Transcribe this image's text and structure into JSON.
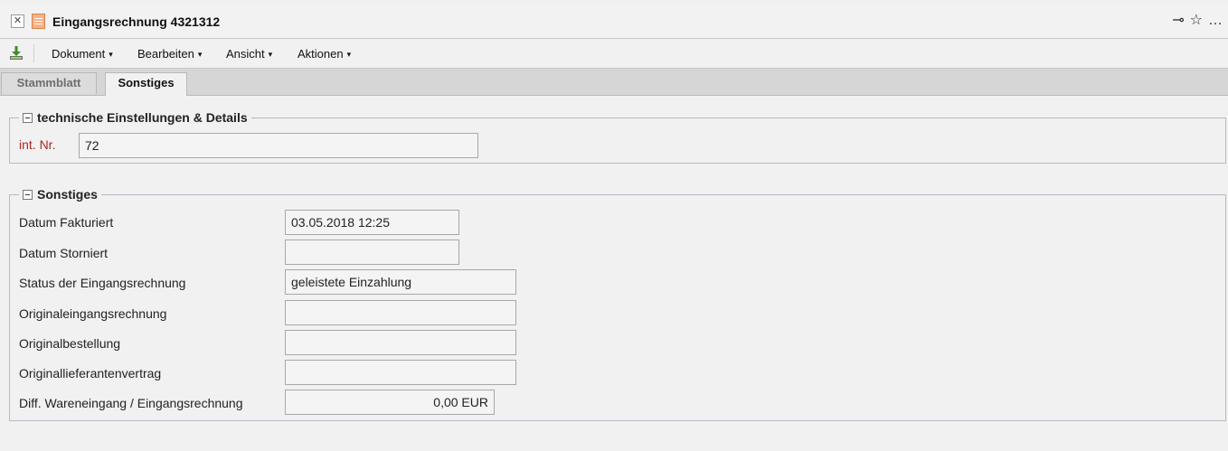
{
  "window": {
    "title": "Eingangsrechnung 4321312",
    "close_glyph": "✕",
    "key_glyph": "⊸",
    "star_glyph": "☆",
    "more_glyph": "…"
  },
  "menu": {
    "items": [
      {
        "label": "Dokument"
      },
      {
        "label": "Bearbeiten"
      },
      {
        "label": "Ansicht"
      },
      {
        "label": "Aktionen"
      }
    ],
    "caret": "▾"
  },
  "tabs": [
    {
      "label": "Stammblatt",
      "active": false
    },
    {
      "label": "Sonstiges",
      "active": true
    }
  ],
  "section_technical": {
    "title": "technische Einstellungen & Details",
    "int_nr_label": "int. Nr.",
    "int_nr_value": "72"
  },
  "section_misc": {
    "title": "Sonstiges",
    "fields": [
      {
        "label": "Datum Fakturiert",
        "value": "03.05.2018 12:25"
      },
      {
        "label": "Datum Storniert",
        "value": ""
      },
      {
        "label": "Status der Eingangsrechnung",
        "value": "geleistete Einzahlung"
      },
      {
        "label": "Originaleingangsrechnung",
        "value": ""
      },
      {
        "label": "Originalbestellung",
        "value": ""
      },
      {
        "label": "Originallieferantenvertrag",
        "value": ""
      },
      {
        "label": "Diff. Wareneingang / Eingangsrechnung",
        "value": "0,00 EUR"
      }
    ]
  },
  "colors": {
    "background": "#f1f1f1",
    "label_required": "#b02525",
    "tab_bar": "#d6d6d6"
  }
}
